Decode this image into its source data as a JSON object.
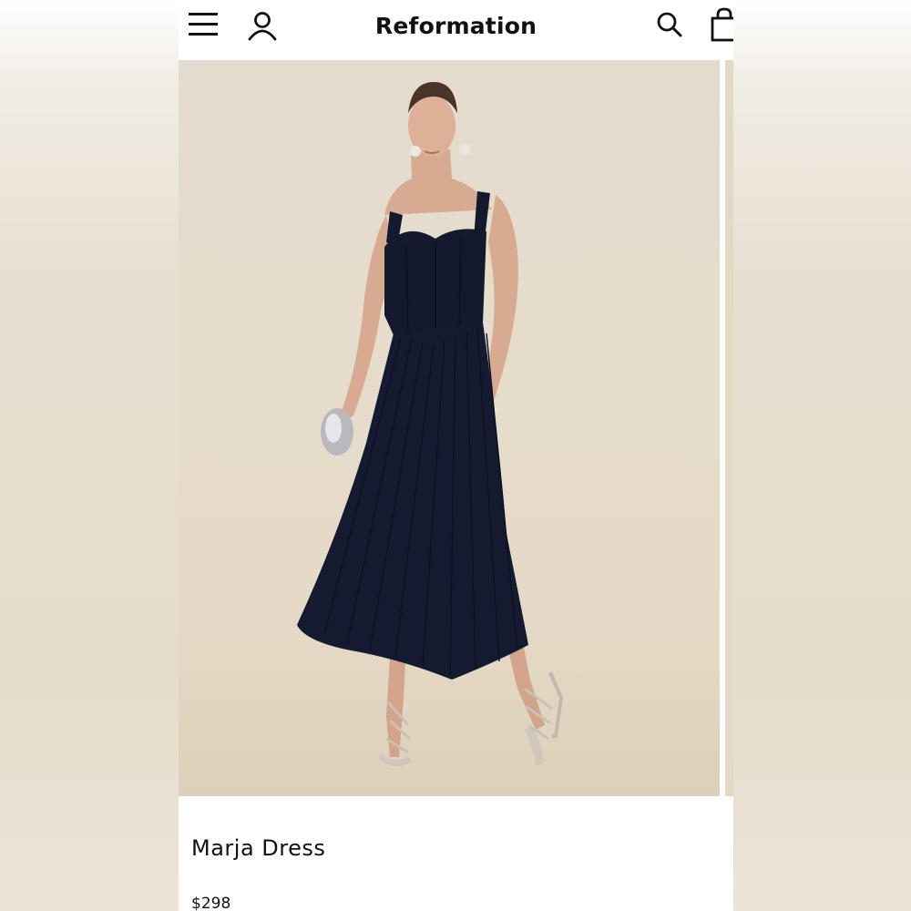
{
  "header": {
    "brand": "Reformation",
    "icons": [
      "menu-icon",
      "account-icon",
      "search-icon",
      "bag-icon"
    ]
  },
  "product": {
    "name": "Marja Dress",
    "price": "$298",
    "image_description_icon": "product-photo"
  },
  "colors": {
    "dress": "#131a2e",
    "backdrop": "#e6dccb",
    "text": "#111111"
  }
}
